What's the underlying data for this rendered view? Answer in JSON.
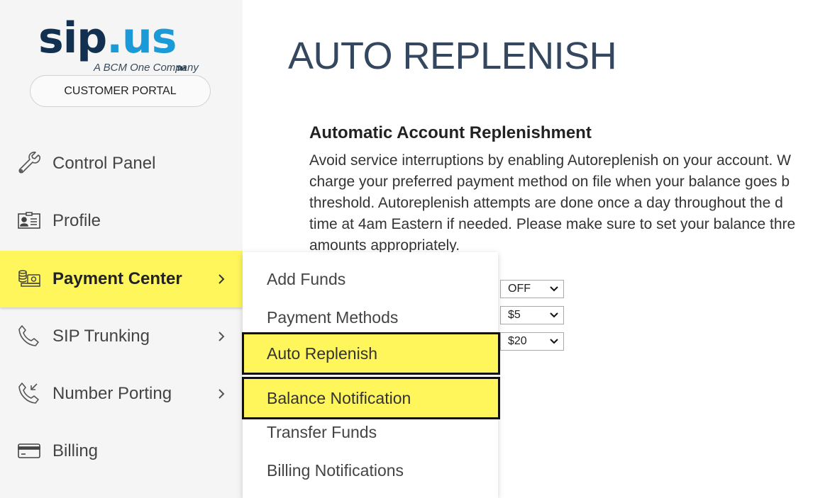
{
  "logo": {
    "part1": "sip",
    "dot": ".",
    "part2": "us",
    "tm": "TM",
    "subtitle": "A BCM One Company"
  },
  "portal_button": "CUSTOMER PORTAL",
  "nav": [
    {
      "label": "Control Panel",
      "icon": "wrench-icon",
      "has_children": false,
      "active": false
    },
    {
      "label": "Profile",
      "icon": "id-card-icon",
      "has_children": false,
      "active": false
    },
    {
      "label": "Payment Center",
      "icon": "coins-icon",
      "has_children": true,
      "active": true
    },
    {
      "label": "SIP Trunking",
      "icon": "phone-icon",
      "has_children": true,
      "active": false
    },
    {
      "label": "Number Porting",
      "icon": "phone-forward-icon",
      "has_children": true,
      "active": false
    },
    {
      "label": "Billing",
      "icon": "credit-card-icon",
      "has_children": false,
      "active": false
    }
  ],
  "page_title": "AUTO REPLENISH",
  "section": {
    "title": "Automatic Account Replenishment",
    "lines": [
      "Avoid service interruptions by enabling Autoreplenish on your account. W",
      "charge your preferred payment method on file when your balance goes b",
      "threshold. Autoreplenish attempts are done once a day throughout the d",
      "time at 4am Eastern if needed. Please make sure to set your balance thre",
      "amounts appropriately."
    ]
  },
  "selects": [
    {
      "value": "OFF"
    },
    {
      "value": "$5"
    },
    {
      "value": "$20"
    }
  ],
  "submenu": [
    {
      "label": "Add Funds",
      "highlighted": false
    },
    {
      "label": "Payment Methods",
      "highlighted": false
    },
    {
      "label": "Auto Replenish",
      "highlighted": true
    },
    {
      "label": "Balance Notification",
      "highlighted": true
    },
    {
      "label": "Transfer Funds",
      "highlighted": false
    },
    {
      "label": "Billing Notifications",
      "highlighted": false
    }
  ],
  "colors": {
    "highlight": "#fef65b",
    "title": "#34475e",
    "logo_dark": "#12304f",
    "logo_blue": "#1a9ad6"
  }
}
